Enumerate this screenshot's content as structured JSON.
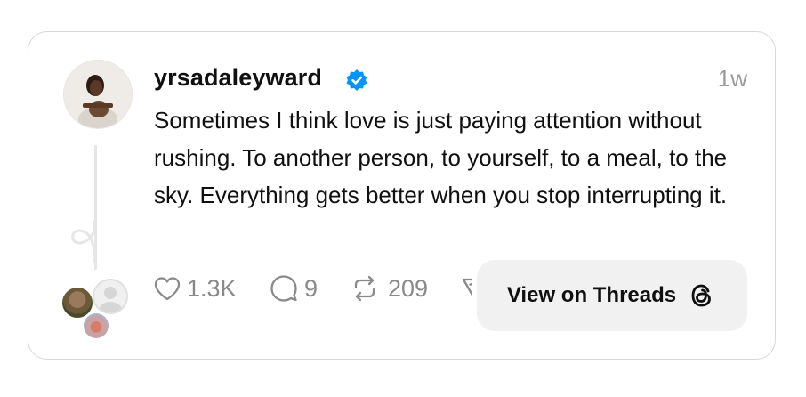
{
  "post": {
    "username": "yrsadaleyward",
    "time": "1w",
    "text": "Sometimes I think love is just paying attention without rushing. To another person, to yourself, to a meal, to the sky. Everything gets better when you stop interrupting it.",
    "verified": true
  },
  "actions": {
    "likes": "1.3K",
    "replies": "9",
    "reposts": "209"
  },
  "button": {
    "label": "View on Threads"
  },
  "colors": {
    "verified": "#0095f6",
    "muted": "#8a8a8a",
    "border": "#d8d8d8"
  },
  "icons": [
    "heart-icon",
    "comment-icon",
    "repost-icon",
    "share-icon",
    "threads-logo-icon",
    "verified-badge-icon"
  ]
}
